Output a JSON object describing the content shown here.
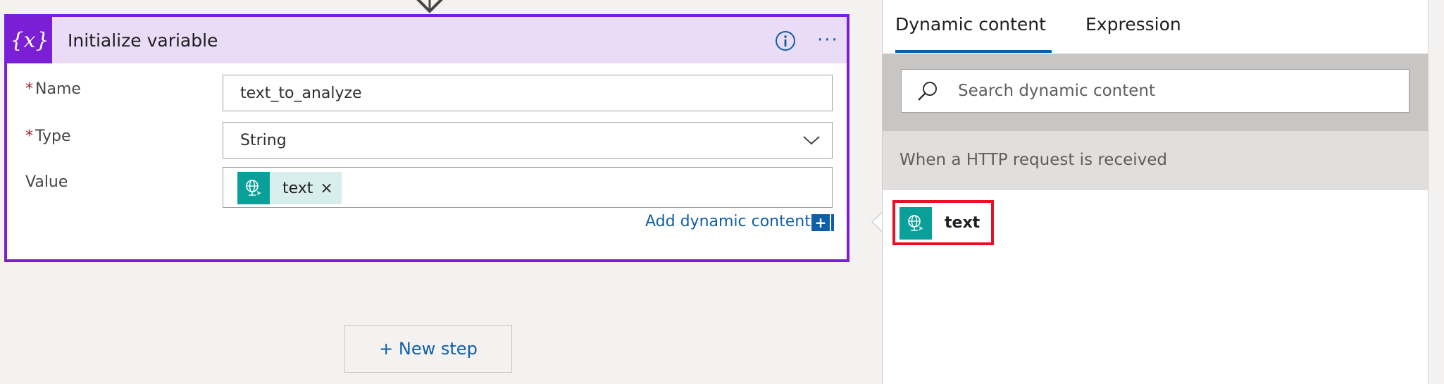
{
  "card": {
    "icon_glyph": "{x}",
    "title": "Initialize variable",
    "icons": [
      "info-icon",
      "more-icon"
    ],
    "more_glyph": "···"
  },
  "fields": {
    "name": {
      "required_mark": "*",
      "label": "Name",
      "value": "text_to_analyze"
    },
    "type": {
      "required_mark": "*",
      "label": "Type",
      "value": "String"
    },
    "value": {
      "label": "Value",
      "token_label": "text",
      "token_remove": "×"
    }
  },
  "add_dynamic": {
    "label": "Add dynamic content",
    "button_glyph": "+"
  },
  "new_step": {
    "label": "+ New step"
  },
  "panel": {
    "tabs": [
      "Dynamic content",
      "Expression"
    ],
    "active_tab": "Dynamic content",
    "search": {
      "placeholder": "Search dynamic content"
    },
    "group": {
      "title": "When a HTTP request is received"
    },
    "items": [
      {
        "label": "text",
        "icon": "http-request-icon"
      }
    ]
  },
  "colors": {
    "accent": "#7b1fd6",
    "header_bg": "#eadcf7",
    "link": "#0f5ea8",
    "token_icon": "#0b9f9a",
    "highlight": "#e81123"
  }
}
